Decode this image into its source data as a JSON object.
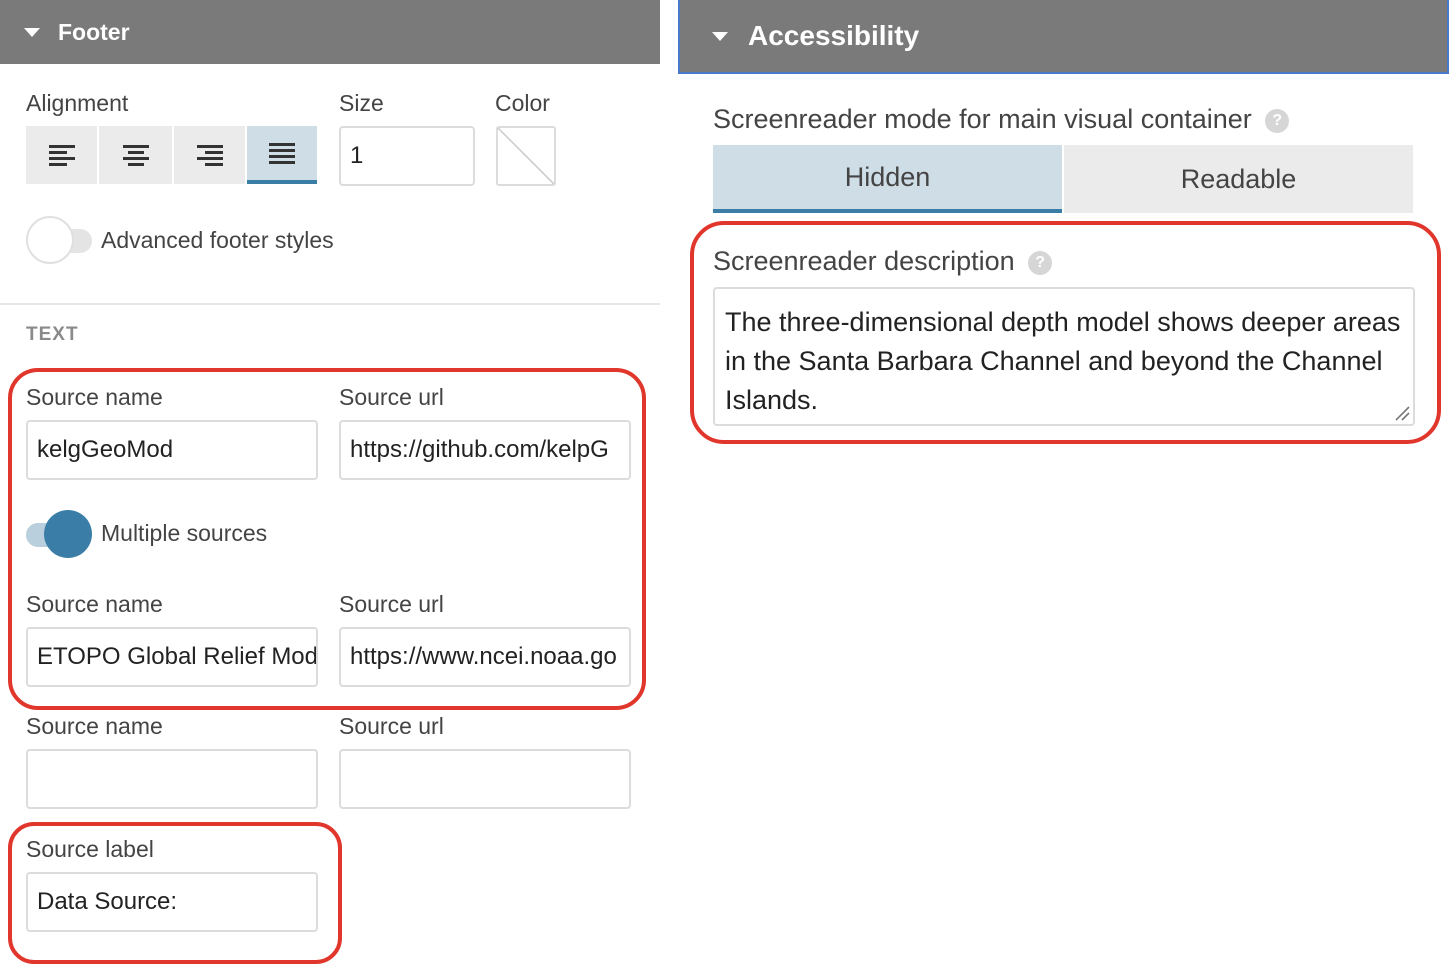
{
  "footer": {
    "header_title": "Footer",
    "alignment_label": "Alignment",
    "size_label": "Size",
    "size_value": "1",
    "color_label": "Color",
    "advanced_label": "Advanced footer styles",
    "text_section": "TEXT",
    "sources": [
      {
        "name_label": "Source name",
        "url_label": "Source url",
        "name_value": "kelgGeoMod",
        "url_value": "https://github.com/kelpG"
      },
      {
        "name_label": "Source name",
        "url_label": "Source url",
        "name_value": "ETOPO Global Relief Mode",
        "url_value": "https://www.ncei.noaa.go"
      },
      {
        "name_label": "Source name",
        "url_label": "Source url",
        "name_value": "",
        "url_value": ""
      }
    ],
    "multiple_sources_label": "Multiple sources",
    "multiple_sources_on": true,
    "advanced_on": false,
    "source_label_label": "Source label",
    "source_label_value": "Data Source:",
    "alignment_options": [
      "align-left-icon",
      "align-center-icon",
      "align-right-icon",
      "align-justify-icon"
    ],
    "alignment_selected": "align-justify-icon"
  },
  "accessibility": {
    "header_title": "Accessibility",
    "mode_label": "Screenreader mode for main visual container",
    "mode_options": [
      "Hidden",
      "Readable"
    ],
    "mode_selected": "Hidden",
    "description_label": "Screenreader description",
    "description_value": "The three-dimensional depth model shows deeper areas in the Santa Barbara Channel and beyond the Channel Islands.",
    "help_glyph": "?"
  },
  "colors": {
    "header_bg": "#7a7a7a",
    "accent": "#3a7ea8",
    "highlight_red": "#e0362c",
    "selected_bg": "#cfdde6"
  }
}
